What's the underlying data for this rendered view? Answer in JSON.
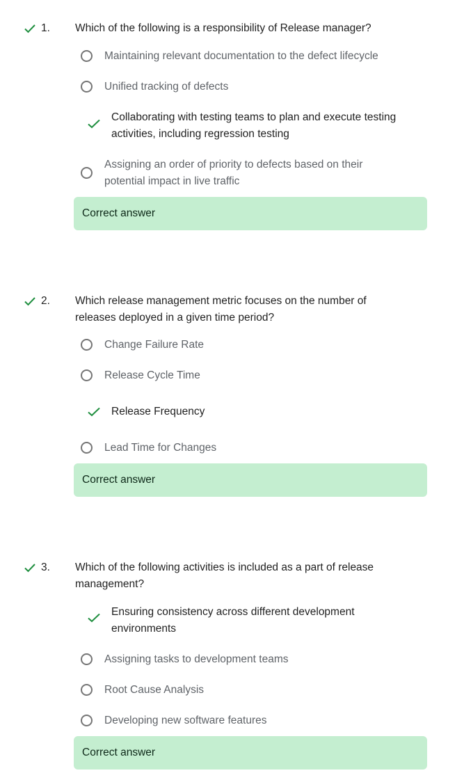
{
  "colors": {
    "check_green": "#1e8e3e",
    "feedback_bg": "#c4eed0",
    "radio_border": "#757575",
    "unselected_text": "#5f6368"
  },
  "questions": [
    {
      "number": "1.",
      "text": "Which of the following is a responsibility of Release manager?",
      "status_icon": "check-icon",
      "options": [
        {
          "label": "Maintaining relevant documentation to the defect lifecycle",
          "selected": false
        },
        {
          "label": "Unified tracking of defects",
          "selected": false
        },
        {
          "label": "Collaborating with testing teams to plan and execute testing activities, including regression testing",
          "selected": true
        },
        {
          "label": "Assigning an order of priority to defects based on their potential impact in live traffic",
          "selected": false
        }
      ],
      "feedback": "Correct answer"
    },
    {
      "number": "2.",
      "text": "Which release management metric focuses on the number of releases deployed in a given time period?",
      "status_icon": "check-icon",
      "options": [
        {
          "label": "Change Failure Rate",
          "selected": false
        },
        {
          "label": "Release Cycle Time",
          "selected": false
        },
        {
          "label": "Release Frequency",
          "selected": true
        },
        {
          "label": "Lead Time for Changes",
          "selected": false
        }
      ],
      "feedback": "Correct answer"
    },
    {
      "number": "3.",
      "text": "Which of the following activities is included as a part of release management?",
      "status_icon": "check-icon",
      "options": [
        {
          "label": "Ensuring consistency across different development environments",
          "selected": true
        },
        {
          "label": "Assigning tasks to development teams",
          "selected": false
        },
        {
          "label": "Root Cause Analysis",
          "selected": false
        },
        {
          "label": "Developing new software features",
          "selected": false
        }
      ],
      "feedback": "Correct answer"
    }
  ]
}
